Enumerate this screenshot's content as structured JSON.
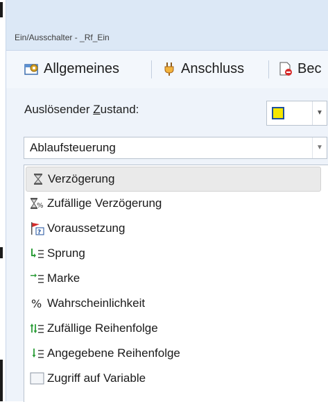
{
  "window": {
    "title": "Ein/Ausschalter - _Rf_Ein"
  },
  "toolbar": {
    "items": [
      {
        "label": "Allgemeines",
        "icon": "settings-window-icon"
      },
      {
        "label": "Anschluss",
        "icon": "plug-icon"
      },
      {
        "label": "Bec",
        "icon": "document-delete-icon"
      }
    ]
  },
  "trigger": {
    "label_before": "Auslösender ",
    "label_underlined": "Z",
    "label_after": "ustand:",
    "state_color": "#f5e600"
  },
  "category_select": {
    "value": "Ablaufsteuerung"
  },
  "list": {
    "items": [
      {
        "label": "Verzögerung",
        "icon": "hourglass-icon",
        "selected": true
      },
      {
        "label": "Zufällige Verzögerung",
        "icon": "hourglass-percent-icon"
      },
      {
        "label": "Voraussetzung",
        "icon": "flag-question-icon"
      },
      {
        "label": "Sprung",
        "icon": "jump-icon"
      },
      {
        "label": "Marke",
        "icon": "marker-icon"
      },
      {
        "label": "Wahrscheinlichkeit",
        "icon": "percent-icon"
      },
      {
        "label": "Zufällige Reihenfolge",
        "icon": "random-order-icon"
      },
      {
        "label": "Angegebene Reihenfolge",
        "icon": "given-order-icon"
      },
      {
        "label": "Zugriff auf Variable",
        "icon": "variable-icon"
      }
    ]
  }
}
